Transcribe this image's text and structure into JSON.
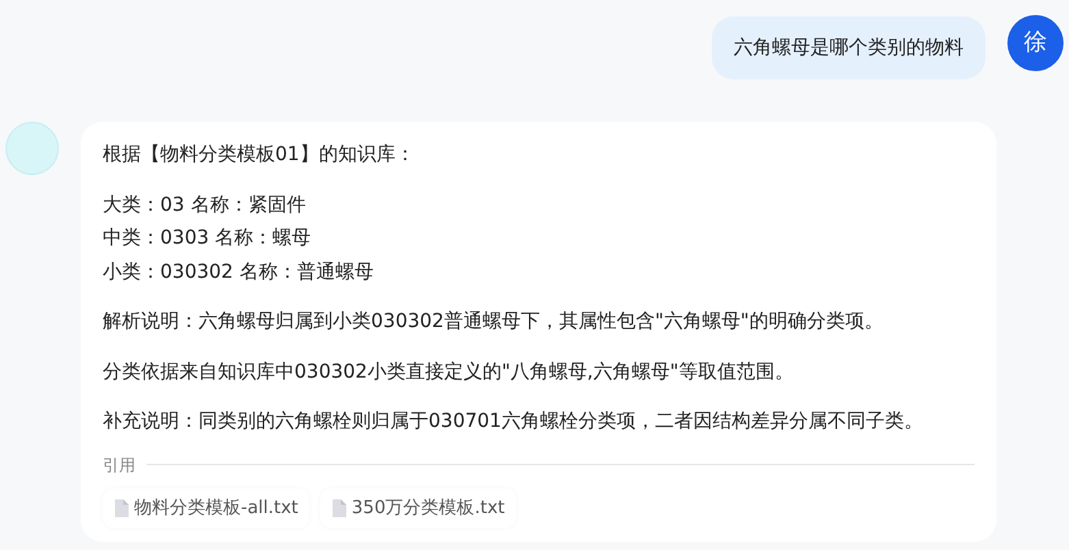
{
  "user_message": {
    "text": "六角螺母是哪个类别的物料",
    "avatar": "徐"
  },
  "answer": {
    "paragraphs": [
      [
        "根据【物料分类模板01】的知识库："
      ],
      [
        "大类：03 名称：紧固件",
        "中类：0303 名称：螺母",
        "小类：030302 名称：普通螺母"
      ],
      [
        "解析说明：六角螺母归属到小类030302普通螺母下，其属性包含\"六角螺母\"的明确分类项。"
      ],
      [
        "分类依据来自知识库中030302小类直接定义的\"八角螺母,六角螺母\"等取值范围。"
      ],
      [
        "补充说明：同类别的六角螺栓则归属于030701六角螺栓分类项，二者因结构差异分属不同子类。"
      ]
    ],
    "citations_label": "引用",
    "citations": [
      "物料分类模板-all.txt",
      "350万分类模板.txt"
    ]
  }
}
